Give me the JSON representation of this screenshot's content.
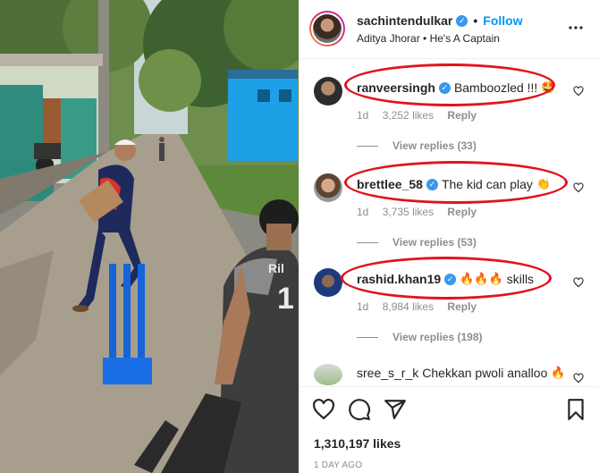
{
  "post": {
    "username": "sachintendulkar",
    "follow_label": "Follow",
    "dot": "•",
    "subtitle": "Aditya Jhorar • He's A Captain",
    "verified_mark": "✓"
  },
  "comments": [
    {
      "username": "ranveersingh",
      "text": "Bamboozled !!!",
      "emoji": "🤩",
      "time": "1d",
      "likes": "3,252 likes",
      "reply": "Reply",
      "view_replies": "View replies (33)",
      "highlighted": true
    },
    {
      "username": "brettlee_58",
      "text": "The kid can play",
      "emoji": "👏",
      "time": "1d",
      "likes": "3,735 likes",
      "reply": "Reply",
      "view_replies": "View replies (53)",
      "highlighted": true
    },
    {
      "username": "rashid.khan19",
      "text": "skills",
      "emoji": "🔥🔥🔥",
      "time": "1d",
      "likes": "8,984 likes",
      "reply": "Reply",
      "view_replies": "View replies (198)",
      "highlighted": true
    },
    {
      "username": "sree_s_r_k",
      "text": "Chekkan pwoli analloo",
      "emoji": "🔥",
      "highlighted": false
    }
  ],
  "actions": {
    "like_icon": "heart-icon",
    "comment_icon": "comment-icon",
    "share_icon": "share-icon",
    "save_icon": "bookmark-icon",
    "likes_count": "1,310,197 likes",
    "posted_ago": "1 DAY AGO"
  },
  "photo": {
    "jersey_text": "Ril",
    "jersey_number": "1"
  },
  "colors": {
    "link_blue": "#0095f6",
    "verified_blue": "#3897f0",
    "highlight_red": "#e0141e",
    "muted_gray": "#8e8e8e"
  }
}
